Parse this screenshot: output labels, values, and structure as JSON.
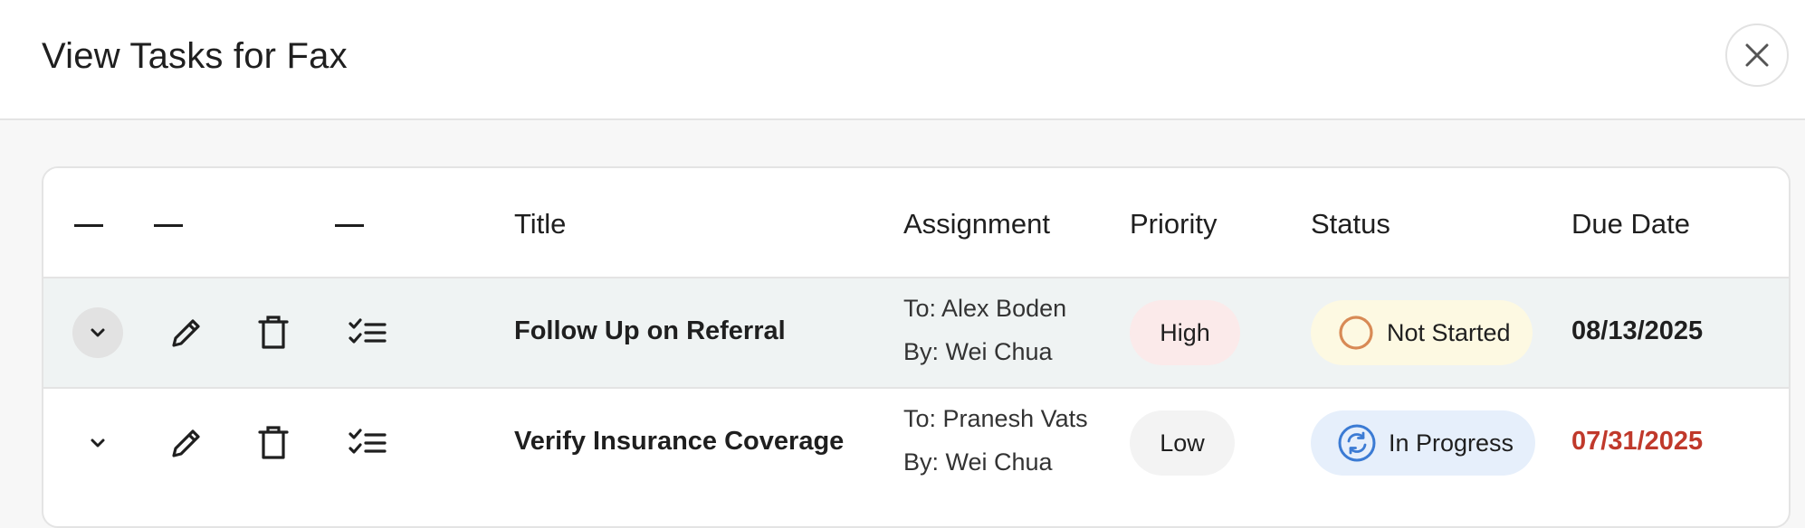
{
  "dialog": {
    "title": "View Tasks for Fax"
  },
  "table": {
    "columns": {
      "col1": "—",
      "col2": "—",
      "col3": "—",
      "title": "Title",
      "assignment": "Assignment",
      "priority": "Priority",
      "status": "Status",
      "due_date": "Due Date"
    },
    "rows": [
      {
        "title": "Follow Up on Referral",
        "to": "To: Alex Boden",
        "by": "By: Wei Chua",
        "priority": "High",
        "status": "Not Started",
        "due_date": "08/13/2025"
      },
      {
        "title": "Verify Insurance Coverage",
        "to": "To: Pranesh Vats",
        "by": "By: Wei Chua",
        "priority": "Low",
        "status": "In Progress",
        "due_date": "07/31/2025"
      }
    ]
  },
  "colors": {
    "priority_high_bg": "#fbeaea",
    "priority_low_bg": "#f3f3f3",
    "status_not_started_bg": "#fdf9e2",
    "status_not_started_icon": "#d88a55",
    "status_in_progress_bg": "#e6effb",
    "status_in_progress_icon": "#3b7bd4",
    "overdue_text": "#c0392b",
    "due_text": "#1f1f1f"
  },
  "icons": {
    "close": "close-icon",
    "expand": "chevron-down-icon",
    "edit": "pencil-icon",
    "delete": "trash-icon",
    "checklist": "checklist-icon",
    "not_started": "circle-outline-icon",
    "in_progress": "sync-icon"
  }
}
